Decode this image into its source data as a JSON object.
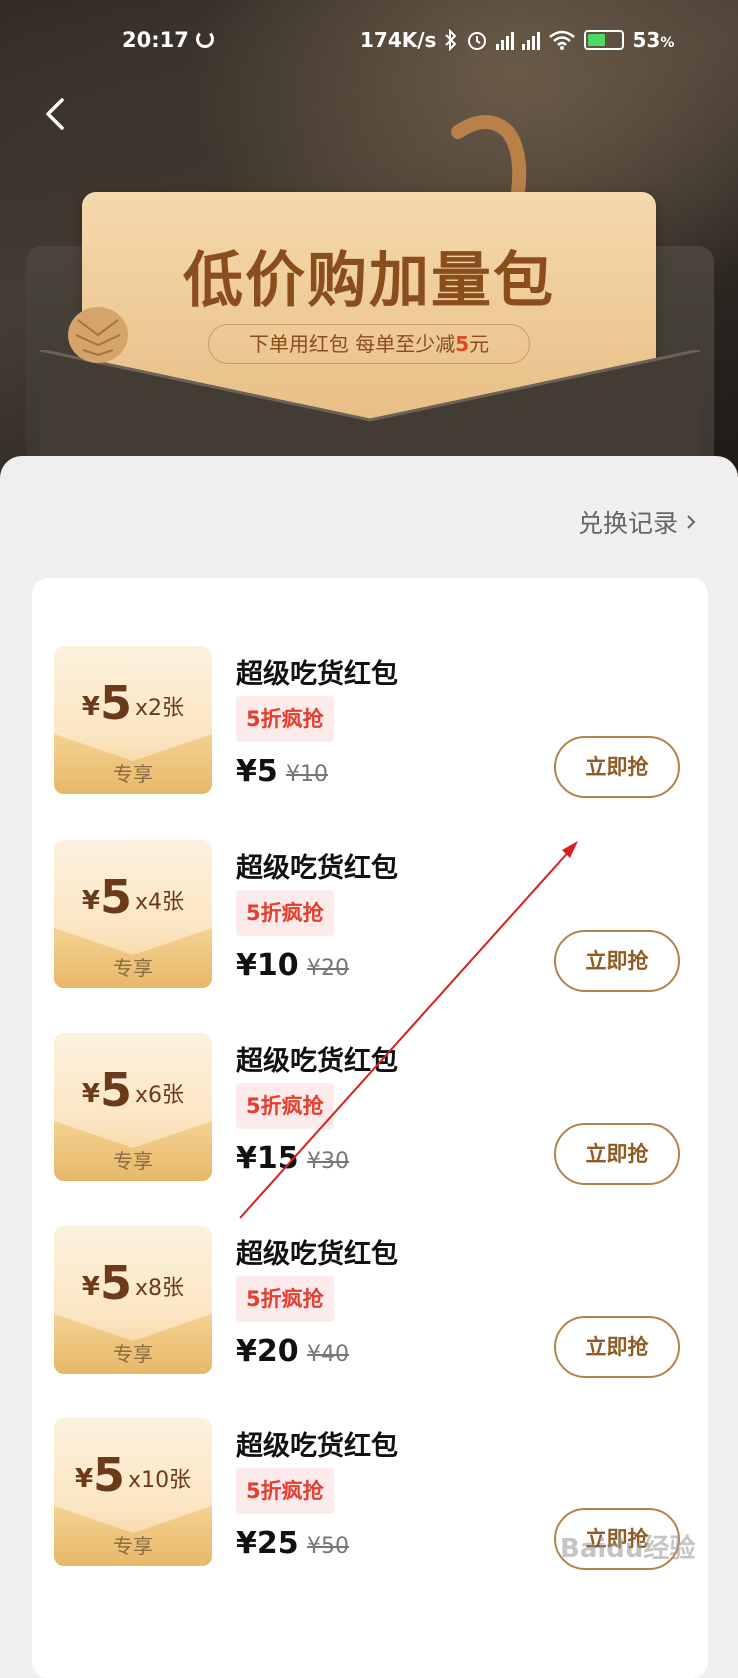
{
  "status_bar": {
    "time": "20:17",
    "network_speed": "174K/s",
    "battery_percent": "53",
    "battery_unit": "%",
    "battery_level": 0.53
  },
  "nav": {
    "back_icon": "chevron-left-icon"
  },
  "banner": {
    "title": "低价购加量包",
    "subtitle_prefix": "下单用红包  每单至少减",
    "subtitle_highlight": "5",
    "subtitle_suffix": "元"
  },
  "history": {
    "label": "兑换记录"
  },
  "items": [
    {
      "coupon_currency": "¥",
      "coupon_value": "5",
      "coupon_count": "x2张",
      "coupon_tag": "专享",
      "title": "超级吃货红包",
      "badge": "5折疯抢",
      "price": "¥5",
      "original_price": "¥10",
      "button": "立即抢"
    },
    {
      "coupon_currency": "¥",
      "coupon_value": "5",
      "coupon_count": "x4张",
      "coupon_tag": "专享",
      "title": "超级吃货红包",
      "badge": "5折疯抢",
      "price": "¥10",
      "original_price": "¥20",
      "button": "立即抢"
    },
    {
      "coupon_currency": "¥",
      "coupon_value": "5",
      "coupon_count": "x6张",
      "coupon_tag": "专享",
      "title": "超级吃货红包",
      "badge": "5折疯抢",
      "price": "¥15",
      "original_price": "¥30",
      "button": "立即抢"
    },
    {
      "coupon_currency": "¥",
      "coupon_value": "5",
      "coupon_count": "x8张",
      "coupon_tag": "专享",
      "title": "超级吃货红包",
      "badge": "5折疯抢",
      "price": "¥20",
      "original_price": "¥40",
      "button": "立即抢"
    },
    {
      "coupon_currency": "¥",
      "coupon_value": "5",
      "coupon_count": "x10张",
      "coupon_tag": "专享",
      "title": "超级吃货红包",
      "badge": "5折疯抢",
      "price": "¥25",
      "original_price": "¥50",
      "button": "立即抢"
    }
  ],
  "watermark": "Baidu经验",
  "colors": {
    "accent_brown": "#8a4d1c",
    "badge_red": "#e53d2f",
    "button_border": "#b4834c",
    "annotation_red": "#d62020"
  }
}
